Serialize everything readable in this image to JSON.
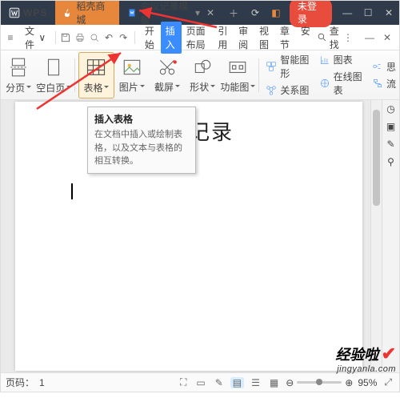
{
  "titlebar": {
    "logo": "WPS",
    "tab_mall": "稻壳商城",
    "tab_doc": "会议记录模板",
    "login": "未登录"
  },
  "menubar": {
    "file": "文件",
    "tabs": [
      "开始",
      "插入",
      "页面布局",
      "引用",
      "审阅",
      "视图",
      "章节",
      "安"
    ],
    "active_index": 1,
    "search": "查找"
  },
  "ribbon": {
    "paging": "分页",
    "blank": "空白页",
    "table": "表格",
    "picture": "图片",
    "screenshot": "截屏",
    "shape": "形状",
    "smartart": "功能图",
    "r1": "智能图形",
    "r2": "图表",
    "r3": "关系图",
    "r4": "在线图表",
    "r5": "思",
    "r6": "流"
  },
  "tooltip": {
    "title": "插入表格",
    "body": "在文档中插入或绘制表格，以及文本与表格的相互转换。"
  },
  "document": {
    "title": "会议记录"
  },
  "statusbar": {
    "page_label": "页码：",
    "page_num": "1",
    "zoom": "95%"
  },
  "watermark": {
    "line1": "经验啦",
    "line2": "jingyanla.com"
  }
}
